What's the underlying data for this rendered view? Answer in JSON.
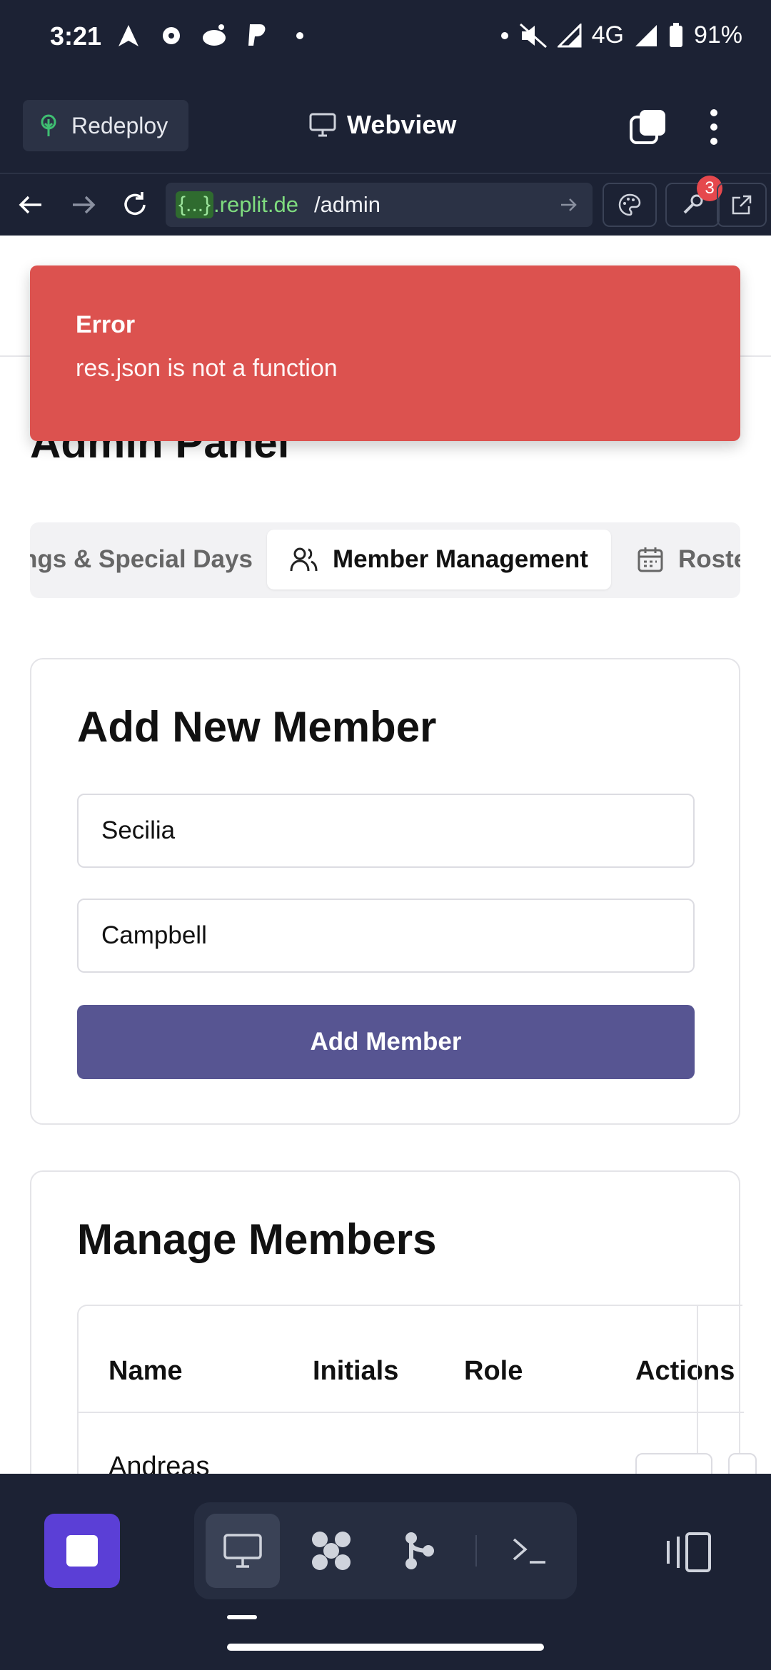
{
  "status_bar": {
    "time": "3:21",
    "network": "4G",
    "battery": "91%"
  },
  "header": {
    "redeploy_label": "Redeploy",
    "title": "Webview",
    "icons": [
      "tree-icon",
      "monitor-icon",
      "tabs-icon",
      "kebab-menu-icon"
    ]
  },
  "url_bar": {
    "host_chip": "{...}",
    "host": ".replit.de",
    "path": "/admin",
    "devtools_badge": "3"
  },
  "toast": {
    "title": "Error",
    "message": "res.json is not a function",
    "color": "#dc524f"
  },
  "page": {
    "title": "Admin Panel",
    "tabs": [
      {
        "label": "ttings & Special Days"
      },
      {
        "label": "Member Management",
        "active": true
      },
      {
        "label": "Roster l"
      }
    ]
  },
  "add_member": {
    "title": "Add New Member",
    "first_name": "Secilia",
    "last_name": "Campbell",
    "button_label": "Add Member",
    "button_color": "#575592"
  },
  "manage_members": {
    "title": "Manage Members",
    "columns": [
      "Name",
      "Initials",
      "Role",
      "Actions"
    ],
    "rows": [
      {
        "name": "Andreas"
      }
    ]
  },
  "bottom_bar": {
    "accent": "#5b3fd6",
    "icons": [
      "stop-icon",
      "desktop-icon",
      "extensions-icon",
      "git-icon",
      "terminal-icon",
      "split-view-icon"
    ]
  }
}
